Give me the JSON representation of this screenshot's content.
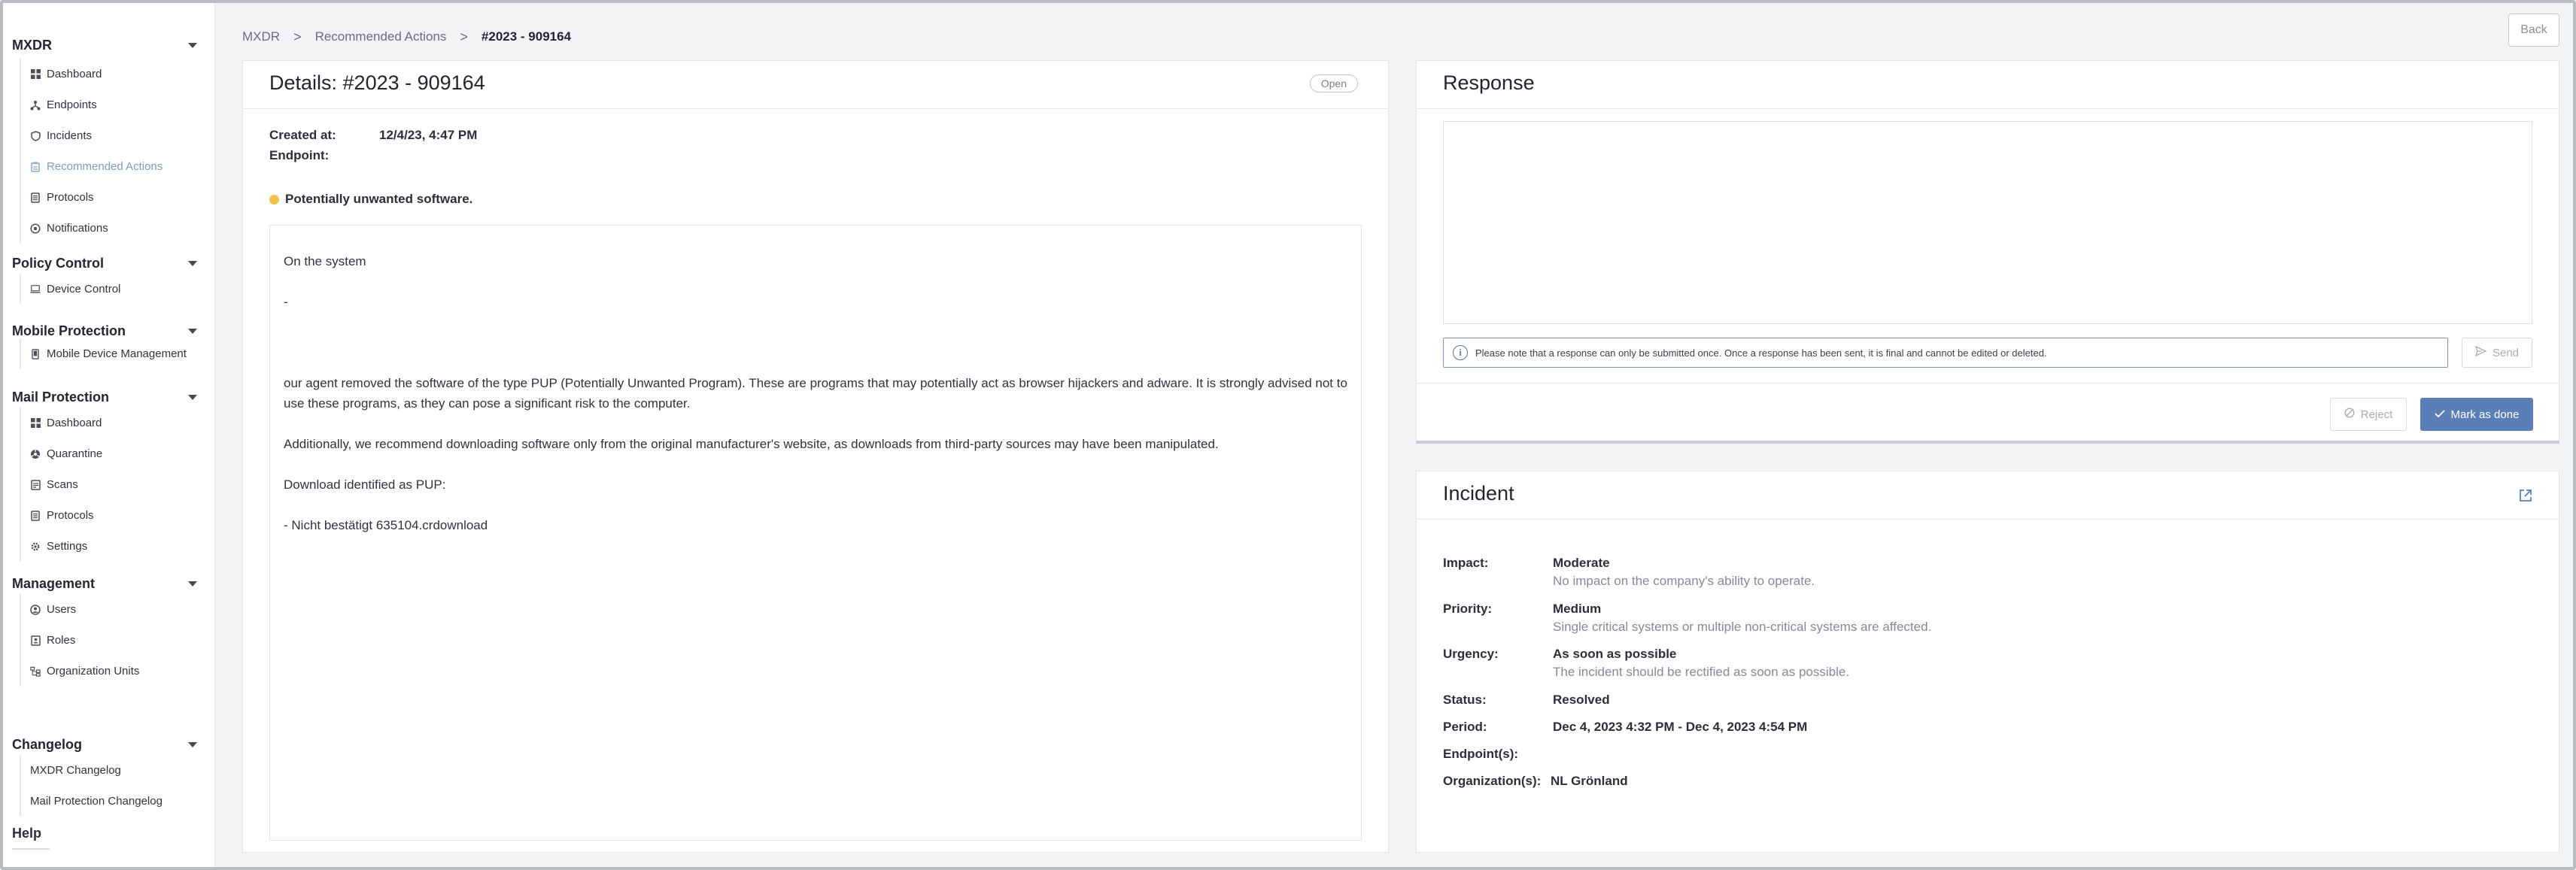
{
  "sidebar": {
    "sections": [
      {
        "title": "MXDR",
        "items": [
          {
            "label": "Dashboard",
            "icon": "grid-icon"
          },
          {
            "label": "Endpoints",
            "icon": "network-icon"
          },
          {
            "label": "Incidents",
            "icon": "shield-icon"
          },
          {
            "label": "Recommended Actions",
            "icon": "clipboard-icon",
            "active": true
          },
          {
            "label": "Protocols",
            "icon": "list-icon"
          },
          {
            "label": "Notifications",
            "icon": "bell-icon"
          }
        ]
      },
      {
        "title": "Policy Control",
        "items": [
          {
            "label": "Device Control",
            "icon": "laptop-icon"
          }
        ]
      },
      {
        "title": "Mobile Protection",
        "items": [
          {
            "label": "Mobile Device Management",
            "icon": "phone-icon"
          }
        ]
      },
      {
        "title": "Mail Protection",
        "items": [
          {
            "label": "Dashboard",
            "icon": "grid-icon"
          },
          {
            "label": "Quarantine",
            "icon": "biohazard-icon"
          },
          {
            "label": "Scans",
            "icon": "scan-icon"
          },
          {
            "label": "Protocols",
            "icon": "list-icon"
          },
          {
            "label": "Settings",
            "icon": "gear-icon"
          }
        ]
      },
      {
        "title": "Management",
        "items": [
          {
            "label": "Users",
            "icon": "users-icon"
          },
          {
            "label": "Roles",
            "icon": "roles-icon"
          },
          {
            "label": "Organization Units",
            "icon": "org-icon"
          }
        ]
      },
      {
        "title": "Changelog",
        "items": [
          {
            "label": "MXDR Changelog"
          },
          {
            "label": "Mail Protection Changelog"
          }
        ]
      }
    ],
    "help": "Help"
  },
  "breadcrumb": {
    "items": [
      "MXDR",
      "Recommended Actions",
      "#2023 - 909164"
    ],
    "separator": ">"
  },
  "back_label": "Back",
  "details": {
    "title": "Details: #2023 - 909164",
    "status": "Open",
    "created_label": "Created at:",
    "created_value": "12/4/23, 4:47 PM",
    "endpoint_label": "Endpoint:",
    "endpoint_value": "",
    "threat": "Potentially unwanted software.",
    "threat_color": "#f2c14b",
    "description": [
      "On the system",
      "-",
      "",
      "our agent removed the software of the type PUP (Potentially Unwanted Program). These are programs that may potentially act as browser hijackers and adware. It is strongly advised not to use these programs, as they can pose a significant risk to the computer.",
      "Additionally, we recommend downloading software only from the original manufacturer's website, as downloads from third-party sources may have been manipulated.",
      "Download identified as PUP:",
      "- Nicht bestätigt 635104.crdownload"
    ]
  },
  "response": {
    "title": "Response",
    "textarea_value": "",
    "notice": "Please note that a response can only be submitted once. Once a response has been sent, it is final and cannot be edited or deleted.",
    "send_label": "Send",
    "reject_label": "Reject",
    "done_label": "Mark as done",
    "accent": "#5a7fb8"
  },
  "incident": {
    "title": "Incident",
    "impact_label": "Impact:",
    "impact_value": "Moderate",
    "impact_desc": "No impact on the company's ability to operate.",
    "priority_label": "Priority:",
    "priority_value": "Medium",
    "priority_desc": "Single critical systems or multiple non-critical systems are affected.",
    "urgency_label": "Urgency:",
    "urgency_value": "As soon as possible",
    "urgency_desc": "The incident should be rectified as soon as possible.",
    "status_label": "Status:",
    "status_value": "Resolved",
    "period_label": "Period:",
    "period_value": "Dec 4, 2023 4:32 PM - Dec 4, 2023 4:54 PM",
    "endpoints_label": "Endpoint(s):",
    "endpoints_value": "",
    "orgs_label": "Organization(s):",
    "orgs_value": "NL Grönland"
  }
}
